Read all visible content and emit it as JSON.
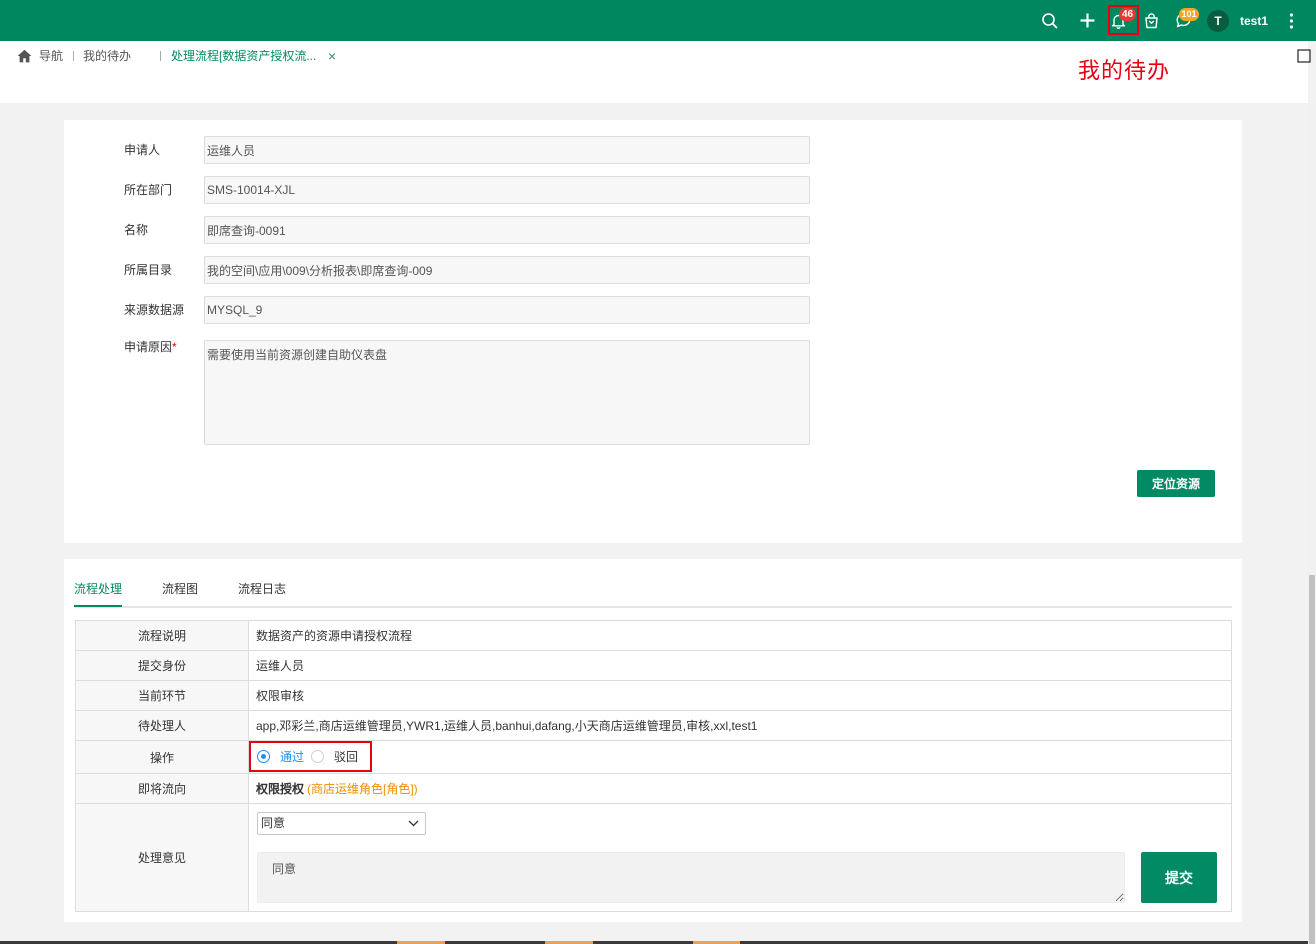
{
  "colors": {
    "primary": "#018a63",
    "topbar": "#00875f",
    "badge_red": "#e8382f",
    "badge_orange": "#f5a623",
    "annotation_red": "#e60012",
    "target_orange": "#f08c00",
    "radio_blue": "#1890ff",
    "avatar": "#0a5c41"
  },
  "topbar": {
    "icons": [
      "search-icon",
      "plus-icon",
      "bell-icon",
      "bag-icon",
      "chat-icon",
      "more-vertical-icon"
    ],
    "notification_badge": "46",
    "message_badge": "101",
    "avatar_initial": "T",
    "username": "test1"
  },
  "breadcrumb": {
    "home_icon": "home-icon",
    "home_label": "导航",
    "tab_todo": "我的待办",
    "tab_active": "处理流程[数据资产授权流...",
    "close_symbol": "×",
    "right_icon": "square-icon"
  },
  "annotation": {
    "todo_hint": "我的待办"
  },
  "form": {
    "fields": [
      {
        "label": "申请人",
        "value": "运维人员"
      },
      {
        "label": "所在部门",
        "value": "SMS-10014-XJL"
      },
      {
        "label": "名称",
        "value": "即席查询-0091"
      },
      {
        "label": "所属目录",
        "value": "我的空间\\应用\\009\\分析报表\\即席查询-009"
      },
      {
        "label": "来源数据源",
        "value": "MYSQL_9"
      }
    ],
    "reason": {
      "label": "申请原因",
      "required_mark": "*",
      "value": "需要使用当前资源创建自助仪表盘"
    },
    "locate_button": "定位资源"
  },
  "tabs": [
    {
      "label": "流程处理",
      "active": true
    },
    {
      "label": "流程图",
      "active": false
    },
    {
      "label": "流程日志",
      "active": false
    }
  ],
  "process": {
    "rows": [
      {
        "label": "流程说明",
        "value": "数据资产的资源申请授权流程"
      },
      {
        "label": "提交身份",
        "value": "运维人员"
      },
      {
        "label": "当前环节",
        "value": "权限审核"
      },
      {
        "label": "待处理人",
        "value": "app,邓彩兰,商店运维管理员,YWR1,运维人员,banhui,dafang,小天商店运维管理员,审核,xxl,test1"
      }
    ],
    "operation": {
      "label": "操作",
      "options": [
        {
          "label": "通过",
          "checked": true
        },
        {
          "label": "驳回",
          "checked": false
        }
      ]
    },
    "next_step": {
      "label": "即将流向",
      "node": "权限授权",
      "target": "(商店运维角色[角色])"
    },
    "opinion": {
      "label": "处理意见",
      "selected": "同意",
      "text": "同意",
      "submit": "提交"
    }
  }
}
